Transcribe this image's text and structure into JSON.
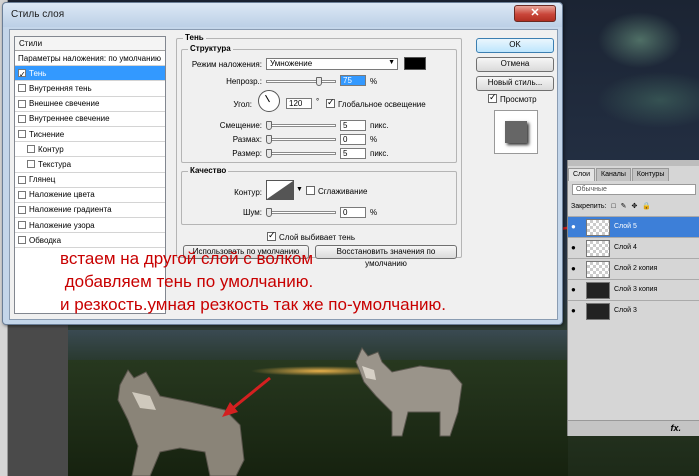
{
  "dialog": {
    "title": "Стиль слоя",
    "close_glyph": "✕",
    "styles_header": "Стили",
    "styles": [
      {
        "label": "Параметры наложения: по умолчанию",
        "checkbox": false,
        "checked": false,
        "sub": false,
        "active": false
      },
      {
        "label": "Тень",
        "checkbox": true,
        "checked": true,
        "sub": false,
        "active": true
      },
      {
        "label": "Внутренняя тень",
        "checkbox": true,
        "checked": false,
        "sub": false,
        "active": false
      },
      {
        "label": "Внешнее свечение",
        "checkbox": true,
        "checked": false,
        "sub": false,
        "active": false
      },
      {
        "label": "Внутреннее свечение",
        "checkbox": true,
        "checked": false,
        "sub": false,
        "active": false
      },
      {
        "label": "Тиснение",
        "checkbox": true,
        "checked": false,
        "sub": false,
        "active": false
      },
      {
        "label": "Контур",
        "checkbox": true,
        "checked": false,
        "sub": true,
        "active": false
      },
      {
        "label": "Текстура",
        "checkbox": true,
        "checked": false,
        "sub": true,
        "active": false
      },
      {
        "label": "Глянец",
        "checkbox": true,
        "checked": false,
        "sub": false,
        "active": false
      },
      {
        "label": "Наложение цвета",
        "checkbox": true,
        "checked": false,
        "sub": false,
        "active": false
      },
      {
        "label": "Наложение градиента",
        "checkbox": true,
        "checked": false,
        "sub": false,
        "active": false
      },
      {
        "label": "Наложение узора",
        "checkbox": true,
        "checked": false,
        "sub": false,
        "active": false
      },
      {
        "label": "Обводка",
        "checkbox": true,
        "checked": false,
        "sub": false,
        "active": false
      }
    ],
    "shadow": {
      "section_title": "Тень",
      "structure_title": "Структура",
      "blend_mode_label": "Режим наложения:",
      "blend_mode_value": "Умножение",
      "shadow_color": "#000000",
      "opacity_label": "Непрозр.:",
      "opacity_value": "75",
      "opacity_level": 0.75,
      "percent": "%",
      "angle_label": "Угол:",
      "angle_value": "120",
      "degree": "°",
      "global_light_label": "Глобальное освещение",
      "global_light_checked": true,
      "distance_label": "Смещение:",
      "distance_value": "5",
      "px_unit": "пикс.",
      "spread_label": "Размах:",
      "spread_value": "0",
      "size_label": "Размер:",
      "size_value": "5",
      "quality_title": "Качество",
      "contour_label": "Контур:",
      "antialias_label": "Сглаживание",
      "antialias_checked": false,
      "noise_label": "Шум:",
      "noise_value": "0",
      "knockout_label": "Слой выбивает тень",
      "knockout_checked": true,
      "make_default_label": "Использовать по умолчанию",
      "reset_default_label": "Восстановить значения по умолчанию"
    },
    "buttons": {
      "ok": "OK",
      "cancel": "Отмена",
      "new_style": "Новый стиль...",
      "preview_label": "Просмотр",
      "preview_checked": true
    }
  },
  "layers_panel": {
    "tabs": [
      "Слои",
      "Каналы",
      "Контуры"
    ],
    "blend_mode": "Обычные",
    "lock_label": "Закрепить:",
    "lock_icons": [
      "□",
      "✎",
      "✥",
      "🔒"
    ],
    "layers": [
      {
        "name": "Слой 5",
        "selected": true,
        "thumb": "transparent"
      },
      {
        "name": "Слой 4",
        "selected": false,
        "thumb": "transparent"
      },
      {
        "name": "Слой 2 копия",
        "selected": false,
        "thumb": "transparent"
      },
      {
        "name": "Слой 3 копия",
        "selected": false,
        "thumb": "dark"
      },
      {
        "name": "Слой 3",
        "selected": false,
        "thumb": "dark"
      }
    ],
    "fx_label": "fx."
  },
  "annotation": {
    "lines": [
      "встаем на другой слой с волком",
      " добавляем тень по умолчанию.",
      "и резкость.умная резкость так же по-умолчанию."
    ],
    "color": "#c80000"
  }
}
